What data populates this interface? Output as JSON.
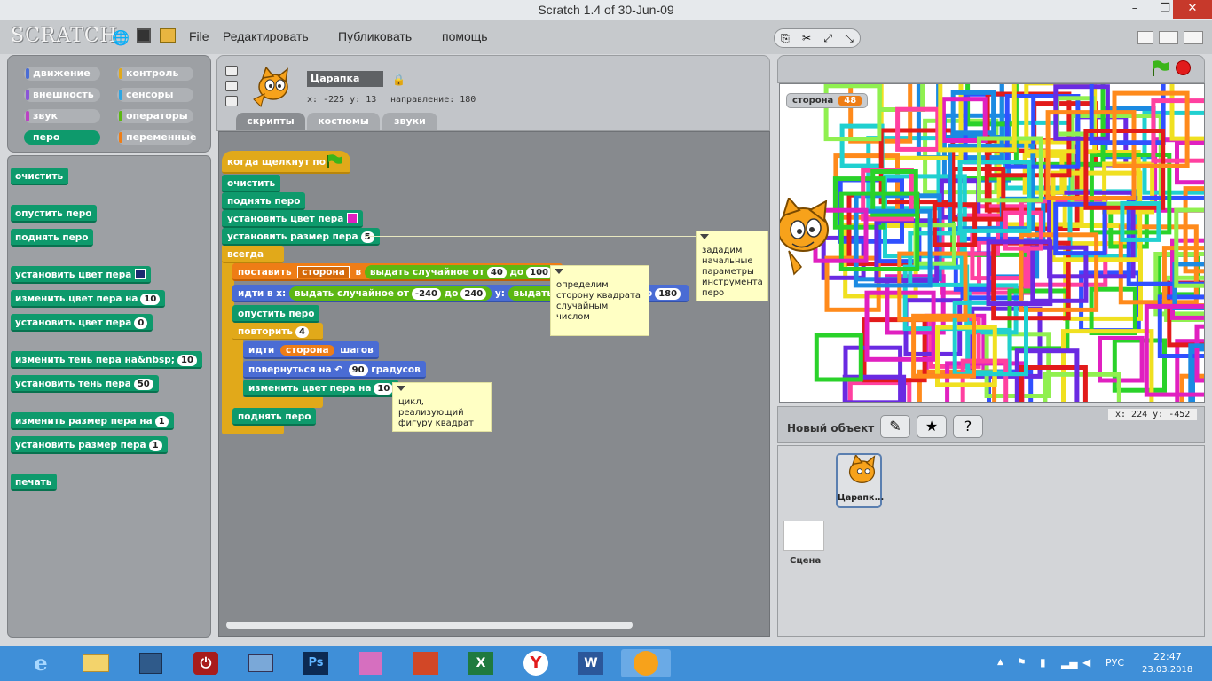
{
  "window": {
    "title": "Scratch 1.4 of 30-Jun-09",
    "min": "–",
    "max": "❐",
    "close": "✕"
  },
  "menu": {
    "logo": "SCRATCH",
    "items": [
      "File",
      "Редактировать",
      "Публиковать",
      "помощь"
    ]
  },
  "categories": [
    {
      "label": "движение",
      "color": "#4a6cd4"
    },
    {
      "label": "контроль",
      "color": "#e1a91a"
    },
    {
      "label": "внешность",
      "color": "#8a55d7"
    },
    {
      "label": "сенсоры",
      "color": "#2ca5e2"
    },
    {
      "label": "звук",
      "color": "#bb42c3"
    },
    {
      "label": "операторы",
      "color": "#5cb712"
    },
    {
      "label": "перо",
      "color": "#0e9a6c"
    },
    {
      "label": "переменные",
      "color": "#ee7d16"
    }
  ],
  "palette": {
    "clear": "очистить",
    "pen_down": "опустить перо",
    "pen_up": "поднять перо",
    "set_color": "установить цвет пера",
    "change_color": "изменить цвет пера на",
    "change_color_val": "10",
    "set_color_num": "установить цвет пера",
    "set_color_num_val": "0",
    "change_shade": "изменить тень пера на&nbsp;",
    "change_shade_val": "10",
    "set_shade": "установить тень пера",
    "set_shade_val": "50",
    "change_size": "изменить размер пера на",
    "change_size_val": "1",
    "set_size": "установить размер пера",
    "set_size_val": "1",
    "stamp": "печать"
  },
  "sprite": {
    "name": "Царапка",
    "coords": "x: -225  y: 13",
    "direction": "направление: 180"
  },
  "tabs": [
    "скрипты",
    "костюмы",
    "звуки"
  ],
  "script": {
    "hat": "когда щелкнут по",
    "clear": "очистить",
    "pen_up": "поднять перо",
    "set_color": "установить цвет пера",
    "set_size": "установить размер пера",
    "set_size_val": "5",
    "forever": "всегда",
    "set_var": "поставить",
    "var_name": "сторона",
    "in": "в",
    "rand": "выдать случайное от",
    "rand_from": "40",
    "to": "до",
    "rand_to": "100",
    "goto": "идти в x:",
    "rand_x_from": "-240",
    "rand_x_to": "240",
    "y": "y:",
    "rand_y_part": "выдать сл",
    "rand_y_to": "180",
    "rand_y_to_frag": "о",
    "pen_down": "опустить перо",
    "repeat": "повторить",
    "repeat_val": "4",
    "move": "идти",
    "steps": "шагов",
    "turn": "повернуться на",
    "turn_val": "90",
    "degrees": "градусов",
    "change_color": "изменить цвет пера на",
    "change_color_val": "10",
    "pen_up2": "поднять перо"
  },
  "notes": {
    "n1": "зададим начальные параметры инструмента перо",
    "n2": "определим сторону квадрата случайным числом",
    "n3": "цикл, реализующий фигуру квадрат"
  },
  "stage": {
    "watcher_label": "сторона",
    "watcher_value": "48",
    "mouse": "x: 224   y: -452"
  },
  "sprites_panel": {
    "new_object": "Новый объект",
    "sprite_label": "Царапк...",
    "stage_label": "Сцена"
  },
  "taskbar": {
    "lang": "РУС",
    "time": "22:47",
    "date": "23.03.2018"
  },
  "colors": {
    "pen_color": "#e020c0",
    "pen_color_palette": "#1a2a70"
  }
}
